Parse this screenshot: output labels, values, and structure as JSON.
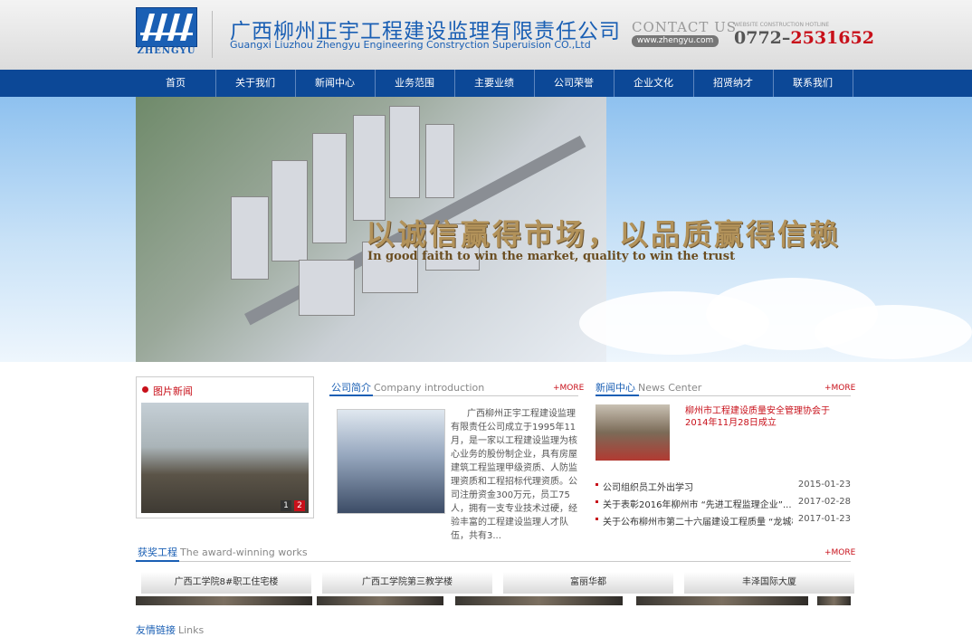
{
  "header": {
    "logo_text": "ZHENGYU",
    "company_cn": "广西柳州正宇工程建设监理有限责任公司",
    "company_en": "Guangxi Liuzhou Zhengyu Engineering Constryction Superuision CO.,Ltd",
    "contact_title": "CONTACT US",
    "website": "www.zhengyu.com",
    "hotline_label": "WEBSITE CONSTRUCTION HOTLINE",
    "hotline_prefix": "0772–",
    "hotline_number": "2531652"
  },
  "nav": [
    "首页",
    "关于我们",
    "新闻中心",
    "业务范围",
    "主要业绩",
    "公司荣誉",
    "企业文化",
    "招贤纳才",
    "联系我们"
  ],
  "banner": {
    "slogan_cn": "以诚信赢得市场，以品质赢得信赖",
    "slogan_en": "In good faith to win the market, quality to win the trust"
  },
  "photo_news": {
    "title": "图片新闻",
    "pages": [
      "1",
      "2"
    ]
  },
  "intro": {
    "title_cn": "公司简介",
    "title_en": "Company introduction",
    "more": "+MORE",
    "text": "广西柳州正宇工程建设监理有限责任公司成立于1995年11月，是一家以工程建设监理为核心业务的股份制企业，具有房屋建筑工程监理甲级资质、人防监理资质和工程招标代理资质。公司注册资金300万元，员工75人，拥有一支专业技术过硬，经验丰富的工程建设监理人才队伍，共有3..."
  },
  "news": {
    "title_cn": "新闻中心",
    "title_en": "News Center",
    "more": "+MORE",
    "headline": "柳州市工程建设质量安全管理协会于2014年11月28日成立",
    "items": [
      {
        "title": "公司组织员工外出学习",
        "date": "2015-01-23"
      },
      {
        "title": "关于表彰2016年柳州市 “先进工程监理企业”...",
        "date": "2017-02-28"
      },
      {
        "title": "关于公布柳州市第二十六届建设工程质量 “龙城杯...",
        "date": "2017-01-23"
      }
    ]
  },
  "awards": {
    "title_cn": "获奖工程",
    "title_en": "The award-winning works",
    "more": "+MORE",
    "items": [
      "广西工学院8#职工住宅楼",
      "广西工学院第三教学楼",
      "富丽华都",
      "丰泽国际大厦"
    ]
  },
  "links": {
    "title_cn": "友情链接",
    "title_en": "Links"
  },
  "colors": {
    "brand_blue": "#0c4897",
    "accent_red": "#c8101a"
  }
}
